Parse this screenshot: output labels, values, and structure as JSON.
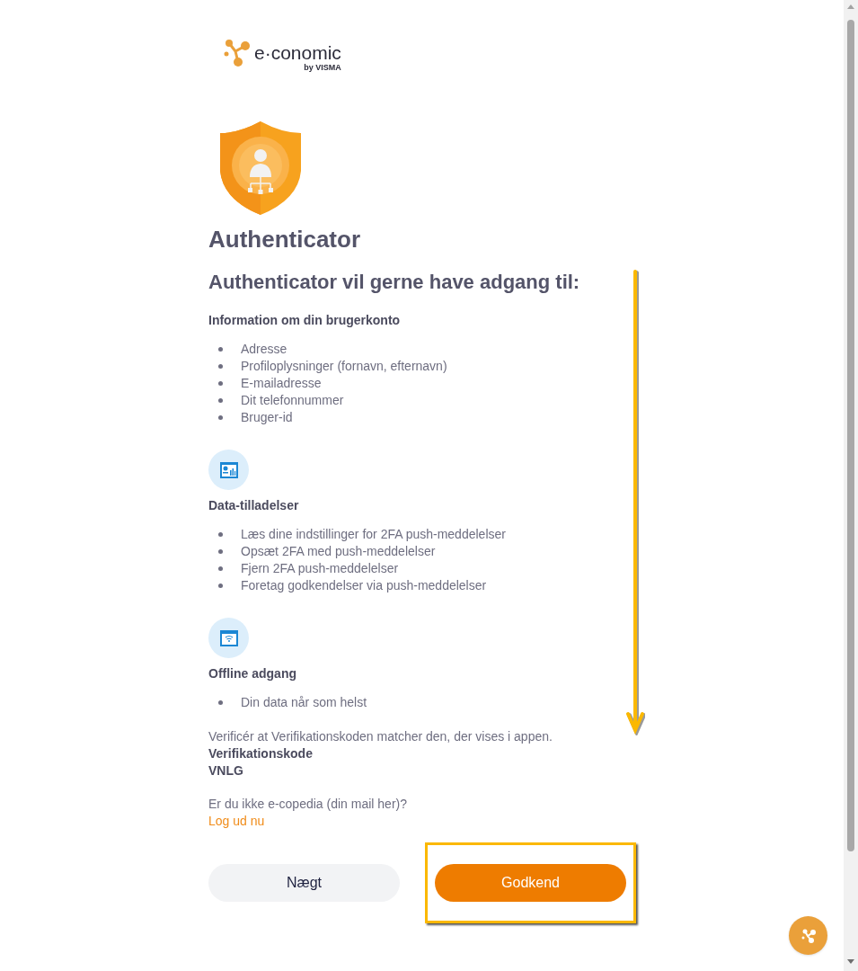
{
  "logo": {
    "name": "e·conomic",
    "tagline": "by VISMA"
  },
  "app_name": "Authenticator",
  "heading": "Authenticator vil gerne have adgang til:",
  "sections": [
    {
      "kind": "plain",
      "title": "Information om din brugerkonto",
      "items": [
        "Adresse",
        "Profiloplysninger (fornavn, efternavn)",
        "E-mailadresse",
        "Dit telefonnummer",
        "Bruger-id"
      ]
    },
    {
      "kind": "data",
      "title": "Data-tilladelser",
      "items": [
        "Læs dine indstillinger for 2FA push-meddelelser",
        "Opsæt 2FA med push-meddelelser",
        "Fjern 2FA push-meddelelser",
        "Foretag godkendelser via push-meddelelser"
      ]
    },
    {
      "kind": "offline",
      "title": "Offline adgang",
      "items": [
        "Din data når som helst"
      ]
    }
  ],
  "verify_text": "Verificér at Verifikationskoden matcher den, der vises i appen.",
  "code_label": "Verifikationskode",
  "code": "VNLG",
  "not_you": "Er du ikke e-copedia (din mail her)?",
  "logout_link": "Log ud nu",
  "buttons": [
    {
      "kind": "secondary",
      "label": "Nægt"
    },
    {
      "kind": "primary",
      "label": "Godkend",
      "highlighted": true
    }
  ]
}
